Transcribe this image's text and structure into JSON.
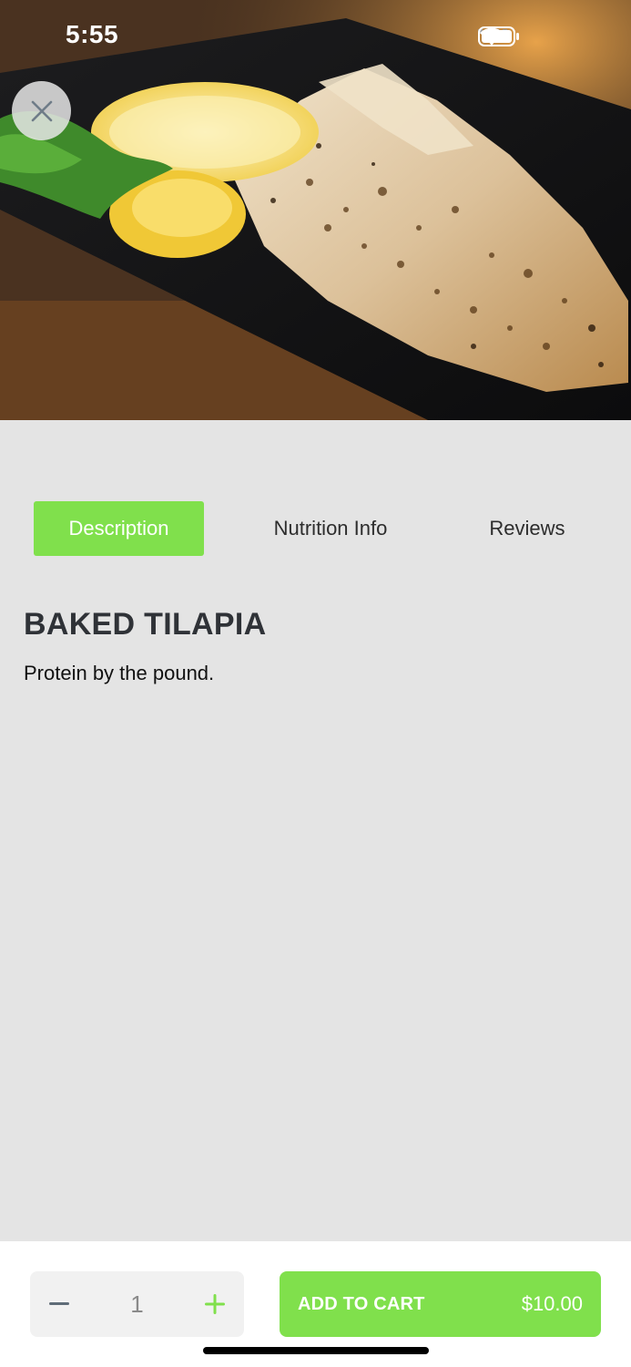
{
  "status_bar": {
    "time": "5:55",
    "icons": [
      "signal-icon",
      "wifi-icon",
      "battery-icon"
    ]
  },
  "hero": {
    "image": "baked-tilapia-photo",
    "close_icon": "close-icon"
  },
  "tabs": [
    {
      "label": "Description",
      "active": true
    },
    {
      "label": "Nutrition Info",
      "active": false
    },
    {
      "label": "Reviews",
      "active": false
    }
  ],
  "product": {
    "title": "BAKED TILAPIA",
    "description": "Protein by the pound."
  },
  "cart_bar": {
    "quantity": "1",
    "minus_icon": "minus-icon",
    "plus_icon": "plus-icon",
    "add_label": "ADD TO CART",
    "price": "$10.00"
  },
  "colors": {
    "accent": "#80e04c",
    "background": "#e4e4e4",
    "title": "#2f3237"
  }
}
